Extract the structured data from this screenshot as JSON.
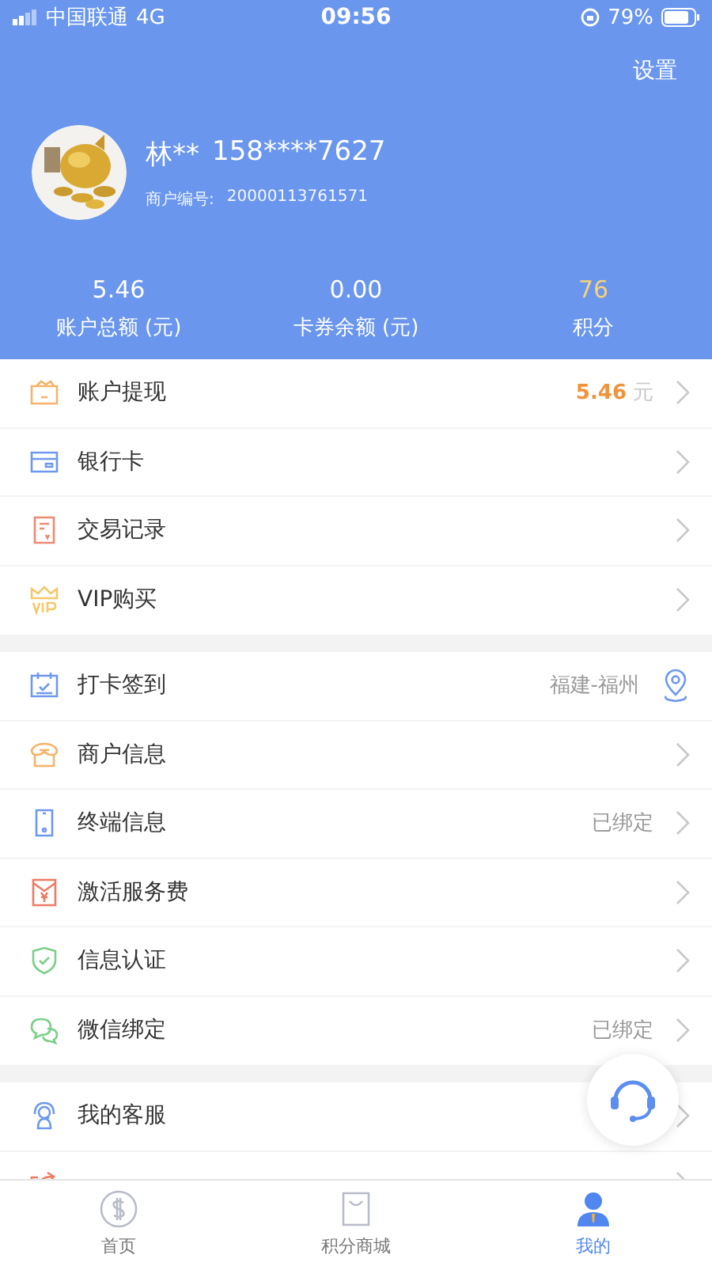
{
  "status_bar": {
    "carrier": "中国联通",
    "network": "4G",
    "time": "09:56",
    "battery": "79%"
  },
  "header": {
    "settings": "设置",
    "name": "林**",
    "phone": "158****7627",
    "merchant_label": "商户编号:",
    "merchant_no": "20000113761571"
  },
  "stats": [
    {
      "value": "5.46",
      "label": "账户总额 (元)",
      "highlight": false
    },
    {
      "value": "0.00",
      "label": "卡券余额 (元)",
      "highlight": false
    },
    {
      "value": "76",
      "label": "积分",
      "highlight": true
    }
  ],
  "groups": [
    {
      "items": [
        {
          "label": "账户提现",
          "kind": "link",
          "value": "5.46",
          "unit": "元"
        },
        {
          "label": "银行卡",
          "kind": "link"
        },
        {
          "label": "交易记录",
          "kind": "link"
        },
        {
          "label": "VIP购买",
          "kind": "link"
        }
      ]
    },
    {
      "items": [
        {
          "label": "打卡签到",
          "kind": "location",
          "value": "福建-福州"
        },
        {
          "label": "商户信息",
          "kind": "link"
        },
        {
          "label": "终端信息",
          "kind": "link",
          "value": "已绑定"
        },
        {
          "label": "激活服务费",
          "kind": "link"
        },
        {
          "label": "信息认证",
          "kind": "link"
        },
        {
          "label": "微信绑定",
          "kind": "link",
          "value": "已绑定"
        }
      ]
    },
    {
      "items": [
        {
          "label": "我的客服",
          "kind": "link"
        },
        {
          "kind": "link"
        }
      ]
    }
  ],
  "tabs": [
    {
      "label": "首页",
      "selected": false
    },
    {
      "label": "积分商城",
      "selected": false
    },
    {
      "label": "我的",
      "selected": true
    }
  ]
}
